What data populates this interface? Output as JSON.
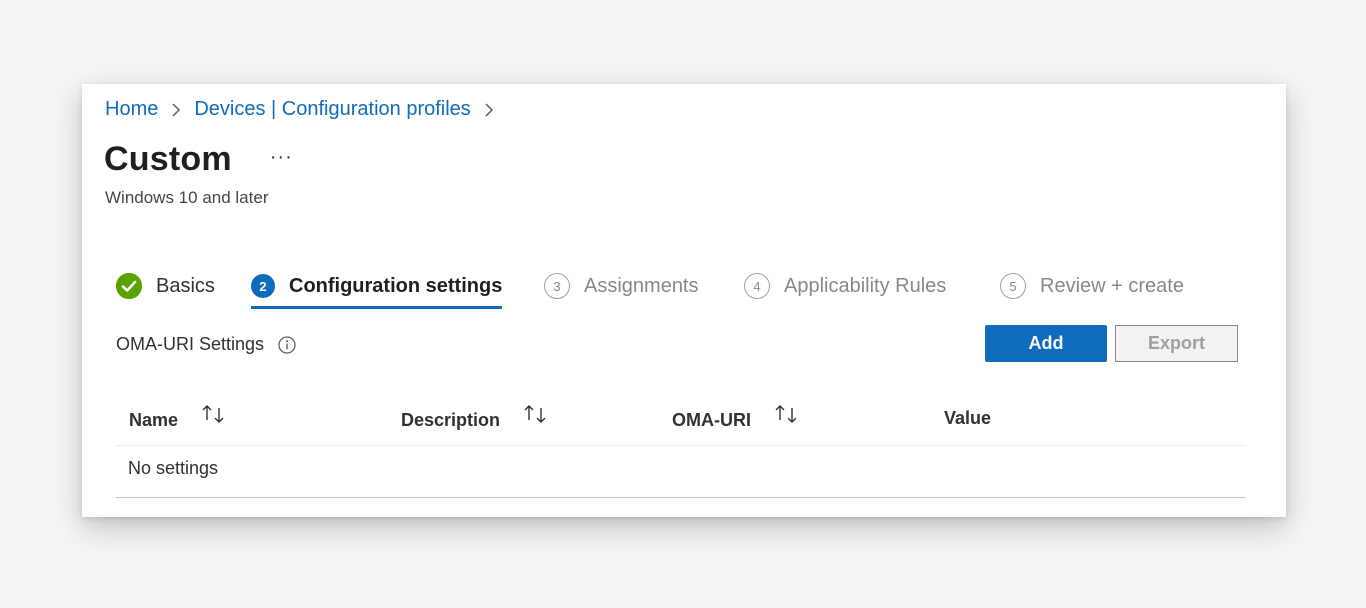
{
  "breadcrumb": {
    "home": "Home",
    "devices": "Devices | Configuration profiles"
  },
  "header": {
    "title": "Custom",
    "more": "···",
    "subtitle": "Windows 10 and later"
  },
  "wizard": {
    "steps": [
      {
        "number": "",
        "label": "Basics",
        "state": "done"
      },
      {
        "number": "2",
        "label": "Configuration settings",
        "state": "active"
      },
      {
        "number": "3",
        "label": "Assignments",
        "state": "pending"
      },
      {
        "number": "4",
        "label": "Applicability Rules",
        "state": "pending"
      },
      {
        "number": "5",
        "label": "Review + create",
        "state": "pending"
      }
    ]
  },
  "settings": {
    "label": "OMA-URI Settings",
    "add_label": "Add",
    "export_label": "Export"
  },
  "table": {
    "columns": [
      "Name",
      "Description",
      "OMA-URI",
      "Value"
    ],
    "empty_text": "No settings"
  },
  "colors": {
    "accent": "#0f6cbd",
    "success": "#57a300"
  }
}
